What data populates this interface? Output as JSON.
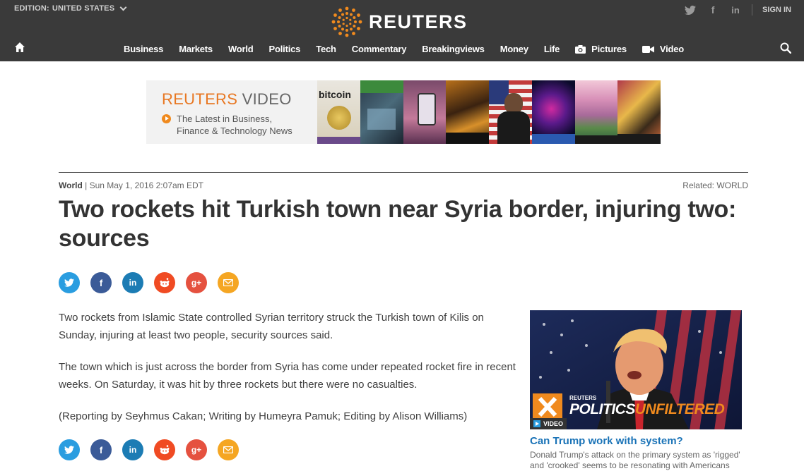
{
  "header": {
    "edition_label": "EDITION:",
    "edition_value": "UNITED STATES",
    "logo_text": "REUTERS",
    "sign_in": "SIGN IN",
    "social": [
      "twitter",
      "facebook",
      "linkedin"
    ]
  },
  "nav": {
    "items": [
      {
        "label": "Business"
      },
      {
        "label": "Markets"
      },
      {
        "label": "World"
      },
      {
        "label": "Politics"
      },
      {
        "label": "Tech"
      },
      {
        "label": "Commentary"
      },
      {
        "label": "Breakingviews"
      },
      {
        "label": "Money"
      },
      {
        "label": "Life"
      },
      {
        "label": "Pictures",
        "icon": "camera-icon"
      },
      {
        "label": "Video",
        "icon": "video-camera-icon"
      }
    ]
  },
  "banner": {
    "title_a": "REUTERS",
    "title_b": "VIDEO",
    "subtitle_line1": "The Latest in Business,",
    "subtitle_line2": "Finance & Technology News",
    "tile_label": "bitcoin"
  },
  "article": {
    "section": "World",
    "date": "| Sun May 1, 2016 2:07am EDT",
    "related_label": "Related:",
    "related_value": "WORLD",
    "headline": "Two rockets hit Turkish town near Syria border, injuring two: sources",
    "paragraphs": [
      "Two rockets from Islamic State controlled Syrian territory struck the Turkish town of Kilis on Sunday, injuring at least two people, security sources said.",
      "The town which is just across the border from Syria has come under repeated rocket fire in recent weeks. On Saturday, it was hit by three rockets but there were no casualties.",
      "(Reporting by Seyhmus Cakan; Writing by Humeyra Pamuk; Editing by Alison Williams)"
    ],
    "share_buttons": [
      {
        "name": "twitter",
        "glyph": "t",
        "color": "#2a9de0"
      },
      {
        "name": "facebook",
        "glyph": "f",
        "color": "#3b5b98"
      },
      {
        "name": "linkedin",
        "glyph": "in",
        "color": "#1c7cb4"
      },
      {
        "name": "reddit",
        "glyph": "☺",
        "color": "#f04b23"
      },
      {
        "name": "google-plus",
        "glyph": "g+",
        "color": "#e5513f"
      },
      {
        "name": "email",
        "glyph": "✉",
        "color": "#f5a623"
      }
    ]
  },
  "sidebar": {
    "overlay_brand": "REUTERS",
    "overlay_title_a": "POLITICS",
    "overlay_title_b": "UNFILTERED",
    "video_tag": "VIDEO",
    "title": "Can Trump work with system?",
    "description": "Donald Trump's attack on the primary system as 'rigged' and 'crooked' seems to be resonating with Americans"
  }
}
